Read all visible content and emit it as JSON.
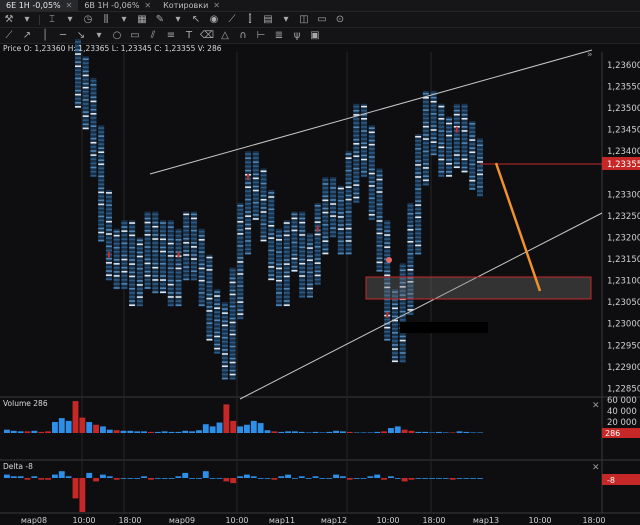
{
  "tabs": [
    {
      "label": "6E 1H -0,05%",
      "active": true
    },
    {
      "label": "6B 1H -0,06%",
      "active": false
    },
    {
      "label": "Котировки",
      "active": false
    }
  ],
  "ohlc_text": "Price O: 1,23360 H: 1,23365 L: 1,23345 C: 1,23355 V: 286",
  "volume_label": "Volume 286",
  "delta_label": "Delta -8",
  "price_axis": [
    "1,23600",
    "1,23550",
    "1,23500",
    "1,23450",
    "1,23400",
    "1,23355",
    "1,23300",
    "1,23250",
    "1,23200",
    "1,23150",
    "1,23100",
    "1,23050",
    "1,23000",
    "1,22950",
    "1,22900",
    "1,22850"
  ],
  "last_price": "1,23355",
  "volume_axis": [
    "60 000",
    "40 000",
    "20 000",
    "286"
  ],
  "delta_axis": [
    "-8"
  ],
  "time_axis": [
    "мар08",
    "10:00",
    "18:00",
    "мар09",
    "10:00",
    "мар11",
    "мар12",
    "10:00",
    "18:00",
    "мар13",
    "10:00",
    "18:00"
  ],
  "colors": {
    "bg": "#0e0e10",
    "up": "#2d8fe8",
    "down": "#c62828",
    "orange": "#f0922e",
    "grid": "#2a2a2a",
    "trend": "#c8c8c8"
  },
  "chart_data": {
    "type": "heatmap",
    "title": "",
    "ylim": [
      1.2283,
      1.2363
    ],
    "ohlc_last": {
      "open": 1.2336,
      "high": 1.23365,
      "low": 1.23345,
      "close": 1.23355,
      "volume": 286
    },
    "close_path": [
      1.2356,
      1.2351,
      1.234,
      1.2325,
      1.2316,
      1.2314,
      1.2318,
      1.231,
      1.2314,
      1.232,
      1.2313,
      1.2318,
      1.231,
      1.2316,
      1.232,
      1.2316,
      1.231,
      1.2302,
      1.2299,
      1.2293,
      1.2307,
      1.2322,
      1.2334,
      1.233,
      1.2325,
      1.2316,
      1.231,
      1.2318,
      1.232,
      1.2312,
      1.2315,
      1.2322,
      1.2328,
      1.2326,
      1.2322,
      1.2334,
      1.2345,
      1.234,
      1.233,
      1.2318,
      1.2302,
      1.2297,
      1.2308,
      1.2322,
      1.2338,
      1.2348,
      1.2345,
      1.234,
      1.2342,
      1.2345,
      1.2341,
      1.2337,
      1.23355
    ],
    "volume_series": [
      6,
      4,
      3,
      3,
      4,
      2,
      3,
      20,
      27,
      22,
      58,
      28,
      20,
      15,
      12,
      6,
      5,
      4,
      4,
      3,
      3,
      2,
      2,
      3,
      2,
      2,
      4,
      3,
      5,
      16,
      12,
      19,
      52,
      22,
      12,
      15,
      22,
      18,
      5,
      3,
      2,
      3,
      3,
      2,
      1,
      2,
      1,
      2,
      4,
      3,
      2,
      1,
      1,
      1,
      2,
      3,
      9,
      12,
      6,
      4,
      2,
      2,
      1,
      2,
      1,
      1,
      3,
      2,
      1,
      1
    ],
    "delta_series": [
      2,
      1,
      1,
      -1,
      1,
      -1,
      -1,
      2,
      4,
      1,
      -12,
      -20,
      3,
      -2,
      2,
      1,
      -1,
      0,
      0,
      0,
      1,
      -1,
      0,
      0,
      0,
      1,
      3,
      0,
      0,
      4,
      0,
      0,
      -2,
      -3,
      1,
      2,
      1,
      0,
      0,
      -1,
      1,
      2,
      0,
      1,
      0,
      1,
      0,
      0,
      2,
      1,
      -1,
      0,
      0,
      1,
      2,
      -1,
      1,
      0,
      -2,
      -1,
      0,
      0,
      0,
      0,
      0,
      -1,
      0,
      0,
      0,
      0
    ]
  }
}
